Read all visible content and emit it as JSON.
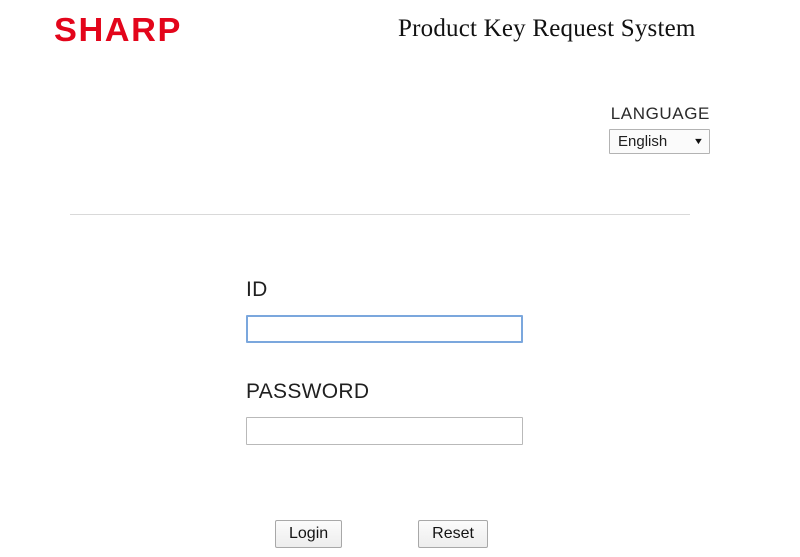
{
  "header": {
    "brand": "SHARP",
    "brand_color": "#e3051b",
    "title": "Product Key Request System"
  },
  "language": {
    "label": "LANGUAGE",
    "selected": "English",
    "caret_icon": "chevron-down-icon",
    "options": [
      "English"
    ]
  },
  "form": {
    "id": {
      "label": "ID",
      "value": "",
      "placeholder": ""
    },
    "password": {
      "label": "PASSWORD",
      "value": "",
      "placeholder": ""
    }
  },
  "buttons": {
    "login": "Login",
    "reset": "Reset"
  }
}
